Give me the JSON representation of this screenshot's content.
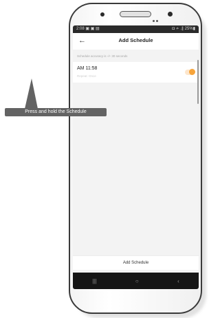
{
  "status_bar": {
    "time": "2:08",
    "left_icons": "▣ ▣ ▤",
    "right_info": "◘ ≁ .∥ 25%▮"
  },
  "app_bar": {
    "back_icon": "←",
    "title": "Add Schedule"
  },
  "hint": "Schedule accuracy is -/+ 30 seconds",
  "schedule": {
    "time": "AM 11:58",
    "subtitle": "Repeat: Once"
  },
  "callout": "Press and hold the Schedule",
  "bottom_button": "Add Schedule",
  "nav": {
    "recents": "|||",
    "home": "○",
    "back": "‹"
  },
  "colors": {
    "accent": "#f7a43a",
    "callout_bg": "#636363"
  }
}
